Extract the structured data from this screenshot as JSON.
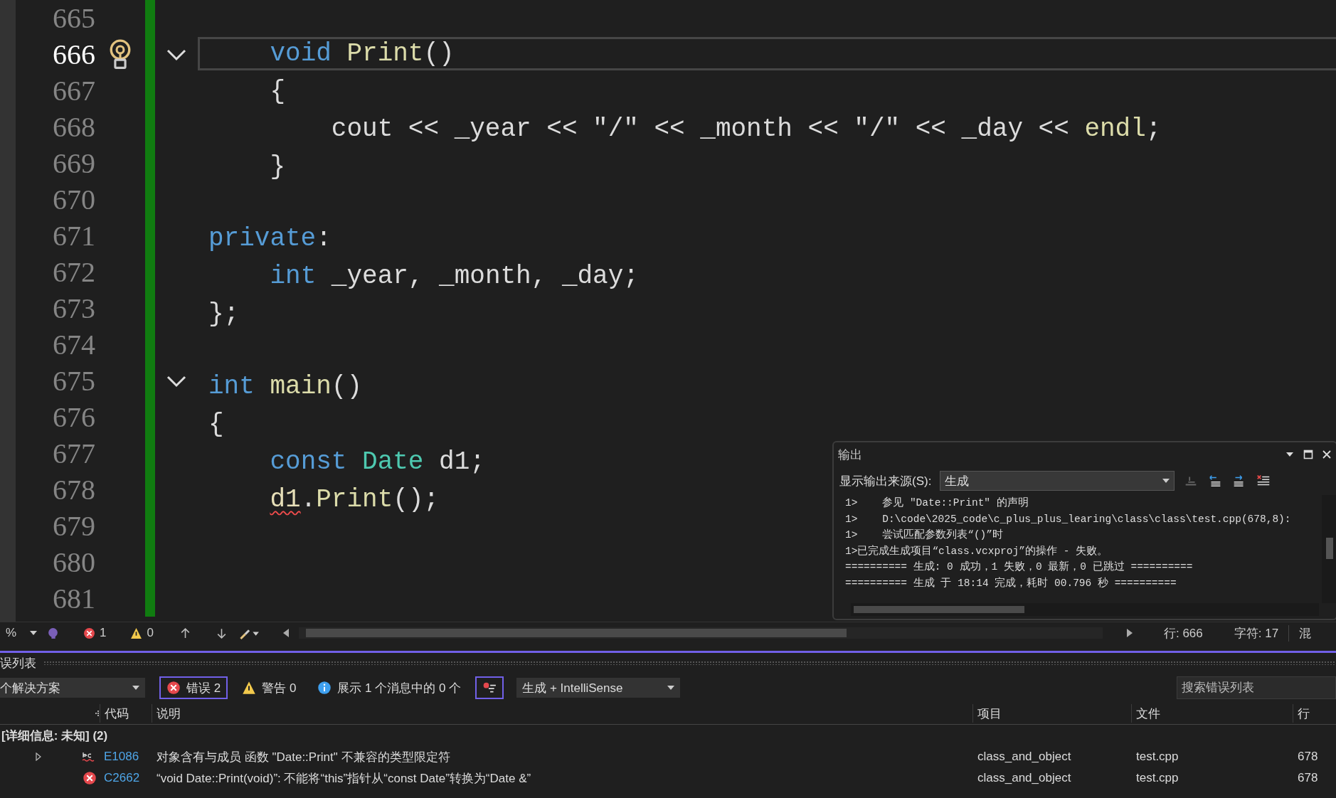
{
  "editor": {
    "lines": [
      {
        "number": "665",
        "current": false,
        "fold": false
      },
      {
        "number": "666",
        "current": true,
        "fold": true,
        "tokens": [
          {
            "kind": "keyword",
            "text": "    void"
          },
          {
            "kind": "function",
            "text": " Print"
          },
          {
            "kind": "plain",
            "text": "()"
          }
        ]
      },
      {
        "number": "667",
        "current": false,
        "fold": false,
        "tokens": [
          {
            "kind": "plain",
            "text": "    {"
          }
        ]
      },
      {
        "number": "668",
        "current": false,
        "fold": false,
        "tokens": [
          {
            "kind": "plain",
            "text": "        cout << _year << \"/\" << _month << \"/\" << _day << "
          },
          {
            "kind": "function",
            "text": "endl"
          },
          {
            "kind": "plain",
            "text": ";"
          }
        ]
      },
      {
        "number": "669",
        "current": false,
        "fold": false,
        "tokens": [
          {
            "kind": "plain",
            "text": "    }"
          }
        ]
      },
      {
        "number": "670",
        "current": false,
        "fold": false
      },
      {
        "number": "671",
        "current": false,
        "fold": false,
        "tokens": [
          {
            "kind": "keyword",
            "text": "private"
          },
          {
            "kind": "plain",
            "text": ":"
          }
        ]
      },
      {
        "number": "672",
        "current": false,
        "fold": false,
        "tokens": [
          {
            "kind": "keyword",
            "text": "    int"
          },
          {
            "kind": "plain",
            "text": " _year, _month, _day;"
          }
        ]
      },
      {
        "number": "673",
        "current": false,
        "fold": false,
        "tokens": [
          {
            "kind": "plain",
            "text": "};"
          }
        ]
      },
      {
        "number": "674",
        "current": false,
        "fold": false
      },
      {
        "number": "675",
        "current": false,
        "fold": true,
        "tokens": [
          {
            "kind": "keyword",
            "text": "int"
          },
          {
            "kind": "function",
            "text": " main"
          },
          {
            "kind": "plain",
            "text": "()"
          }
        ]
      },
      {
        "number": "676",
        "current": false,
        "fold": false,
        "tokens": [
          {
            "kind": "plain",
            "text": "{"
          }
        ]
      },
      {
        "number": "677",
        "current": false,
        "fold": false,
        "tokens": [
          {
            "kind": "keyword",
            "text": "    const"
          },
          {
            "kind": "type",
            "text": " Date"
          },
          {
            "kind": "plain",
            "text": " d1;"
          }
        ]
      },
      {
        "number": "678",
        "current": false,
        "fold": false,
        "tokens": [
          {
            "kind": "variable",
            "text": "    d1",
            "error": true
          },
          {
            "kind": "plain",
            "text": "."
          },
          {
            "kind": "function",
            "text": "Print"
          },
          {
            "kind": "plain",
            "text": "();"
          }
        ]
      },
      {
        "number": "679",
        "current": false,
        "fold": false
      },
      {
        "number": "680",
        "current": false,
        "fold": false
      },
      {
        "number": "681",
        "current": false,
        "fold": false
      }
    ]
  },
  "output": {
    "title": "输出",
    "source_label": "显示输出来源(S):",
    "source": "生成",
    "lines": [
      "1>    参见 \"Date::Print\" 的声明",
      "1>    D:\\code\\2025_code\\c_plus_plus_learing\\class\\class\\test.cpp(678,8):",
      "1>    尝试匹配参数列表“()”时",
      "1>已完成生成项目“class.vcxproj”的操作 - 失败。",
      "========== 生成: 0 成功，1 失败，0 最新，0 已跳过 ==========",
      "========== 生成 于 18:14 完成，耗时 00.796 秒 =========="
    ]
  },
  "status_bar": {
    "zoom": "%",
    "errors": "1",
    "warnings": "0",
    "line": "行: 666",
    "char": "字符: 17",
    "encoding": "混"
  },
  "error_list": {
    "title": "误列表",
    "scope": "个解决方案",
    "filters": [
      {
        "kind": "error",
        "label": "错误 2",
        "selected": true
      },
      {
        "kind": "warning",
        "label": "警告 0",
        "selected": false
      },
      {
        "kind": "info",
        "label": "展示 1 个消息中的 0 个",
        "selected": false
      }
    ],
    "build_filter": {
      "selected": true
    },
    "source": "生成 + IntelliSense",
    "search": {
      "placeholder": "搜索错误列表"
    },
    "columns": [
      "代码",
      "说明",
      "项目",
      "文件",
      "行"
    ],
    "group": "[详细信息: 未知] (2)",
    "rows": [
      {
        "kind": "intellisense",
        "expandable": true,
        "code": "E1086",
        "description": "对象含有与成员 函数 \"Date::Print\" 不兼容的类型限定符",
        "project": "class_and_object",
        "file": "test.cpp",
        "line": "678"
      },
      {
        "kind": "error",
        "expandable": false,
        "code": "C2662",
        "description": "“void Date::Print(void)”: 不能将“this”指针从“const Date”转换为“Date &”",
        "project": "class_and_object",
        "file": "test.cpp",
        "line": "678"
      }
    ]
  }
}
